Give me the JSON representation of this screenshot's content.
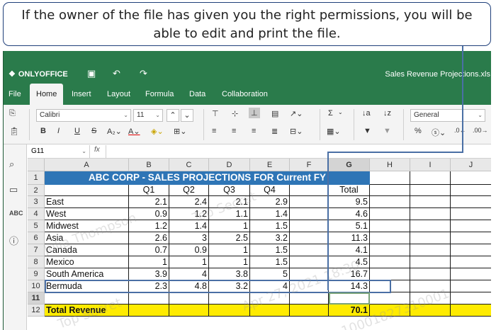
{
  "callout": {
    "line1": "If the owner of the file has given you the right permissions, you will be",
    "line2": "able to edit and print the file."
  },
  "app": {
    "brand": "ONLYOFFICE",
    "doc_title": "Sales Revenue Projections.xls",
    "tabs": [
      "File",
      "Home",
      "Insert",
      "Layout",
      "Formula",
      "Data",
      "Collaboration"
    ],
    "active_tab": "Home"
  },
  "toolbar": {
    "font_name": "Calibri",
    "font_size": "11",
    "number_format": "General",
    "bold": "B",
    "italic": "I",
    "underline": "U",
    "strike": "S",
    "sum": "Σ",
    "percent": "%"
  },
  "formula_bar": {
    "cell_ref": "G11",
    "fx": "fx"
  },
  "columns": [
    "A",
    "B",
    "C",
    "D",
    "E",
    "F",
    "G",
    "H",
    "I",
    "J"
  ],
  "rows": [
    "1",
    "2",
    "3",
    "4",
    "5",
    "6",
    "7",
    "8",
    "9",
    "10",
    "11",
    "12"
  ],
  "sheet": {
    "banner": "ABC CORP  - SALES PROJECTIONS FOR Current FY",
    "headers": {
      "q1": "Q1",
      "q2": "Q2",
      "q3": "Q3",
      "q4": "Q4",
      "total": "Total"
    },
    "data": [
      {
        "region": "East",
        "q1": "2.1",
        "q2": "2.4",
        "q3": "2.1",
        "q4": "2.9",
        "total": "9.5"
      },
      {
        "region": "West",
        "q1": "0.9",
        "q2": "1.2",
        "q3": "1.1",
        "q4": "1.4",
        "total": "4.6"
      },
      {
        "region": "Midwest",
        "q1": "1.2",
        "q2": "1.4",
        "q3": "1",
        "q4": "1.5",
        "total": "5.1"
      },
      {
        "region": "Asia",
        "q1": "2.6",
        "q2": "3",
        "q3": "2.5",
        "q4": "3.2",
        "total": "11.3"
      },
      {
        "region": "Canada",
        "q1": "0.7",
        "q2": "0.9",
        "q3": "1",
        "q4": "1.5",
        "total": "4.1"
      },
      {
        "region": "Mexico",
        "q1": "1",
        "q2": "1",
        "q3": "1",
        "q4": "1.5",
        "total": "4.5"
      },
      {
        "region": "South America",
        "q1": "3.9",
        "q2": "4",
        "q3": "3.8",
        "q4": "5",
        "total": "16.7"
      },
      {
        "region": "Bermuda",
        "q1": "2.3",
        "q2": "4.8",
        "q3": "3.2",
        "q4": "4",
        "total": "14.3"
      }
    ],
    "total_label": "Total Revenue",
    "total_value": "70.1"
  },
  "watermark": {
    "name": "Julia Thompson",
    "class": "Top Secret",
    "stamp": "Apr 27, 2021 18:30",
    "id": "10001827310001"
  }
}
